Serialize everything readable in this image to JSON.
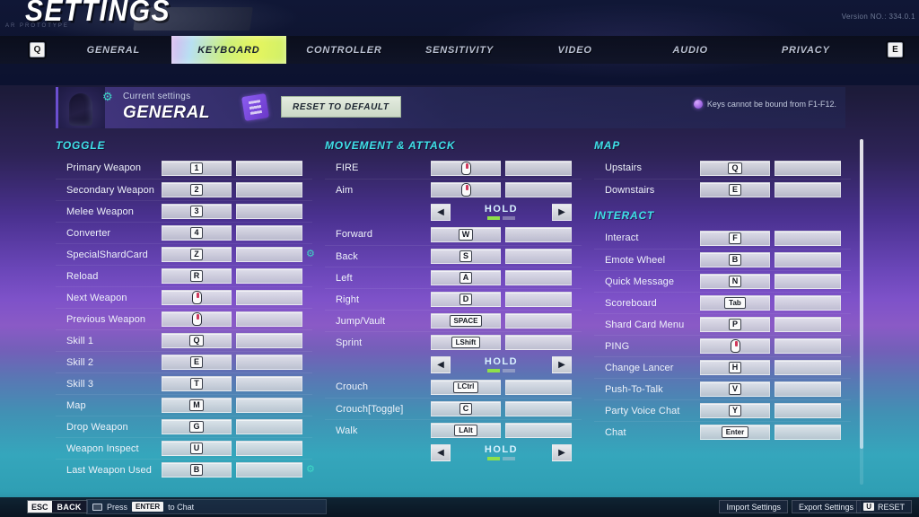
{
  "header": {
    "title": "SETTINGS",
    "subtitle": "AR  PROTOTYPE",
    "version": "Version NO.: 334.0.1"
  },
  "tabbar": {
    "left_key": "Q",
    "right_key": "E",
    "tabs": [
      {
        "label": "GENERAL",
        "active": false
      },
      {
        "label": "KEYBOARD",
        "active": true
      },
      {
        "label": "CONTROLLER",
        "active": false
      },
      {
        "label": "SENSITIVITY",
        "active": false
      },
      {
        "label": "VIDEO",
        "active": false
      },
      {
        "label": "AUDIO",
        "active": false
      },
      {
        "label": "PRIVACY",
        "active": false
      }
    ]
  },
  "current_settings": {
    "label": "Current settings",
    "value": "GENERAL",
    "reset_to_default": "RESET TO DEFAULT",
    "warning": "Keys cannot be bound from F1-F12."
  },
  "columns": {
    "left": {
      "section": "TOGGLE",
      "rows": [
        {
          "label": "Primary Weapon",
          "key": "1",
          "type": "key",
          "secondary": ""
        },
        {
          "label": "Secondary Weapon",
          "key": "2",
          "type": "key",
          "secondary": ""
        },
        {
          "label": "Melee Weapon",
          "key": "3",
          "type": "key",
          "secondary": ""
        },
        {
          "label": "Converter",
          "key": "4",
          "type": "key",
          "secondary": ""
        },
        {
          "label": "SpecialShardCard",
          "key": "Z",
          "type": "key",
          "secondary": "",
          "gear": true
        },
        {
          "label": "Reload",
          "key": "R",
          "type": "key",
          "secondary": ""
        },
        {
          "label": "Next Weapon",
          "key": "",
          "type": "mouse",
          "secondary": ""
        },
        {
          "label": "Previous Weapon",
          "key": "",
          "type": "mouse",
          "secondary": ""
        },
        {
          "label": "Skill 1",
          "key": "Q",
          "type": "key",
          "secondary": ""
        },
        {
          "label": "Skill 2",
          "key": "E",
          "type": "key",
          "secondary": ""
        },
        {
          "label": "Skill 3",
          "key": "T",
          "type": "key",
          "secondary": ""
        },
        {
          "label": "Map",
          "key": "M",
          "type": "key",
          "secondary": ""
        },
        {
          "label": "Drop Weapon",
          "key": "G",
          "type": "key",
          "secondary": ""
        },
        {
          "label": "Weapon Inspect",
          "key": "U",
          "type": "key",
          "secondary": ""
        },
        {
          "label": "Last Weapon Used",
          "key": "B",
          "type": "key",
          "secondary": "",
          "gear": true
        }
      ]
    },
    "mid": {
      "section": "MOVEMENT & ATTACK",
      "rows": [
        {
          "label": "FIRE",
          "key": "",
          "type": "mouse",
          "secondary": ""
        },
        {
          "label": "Aim",
          "key": "",
          "type": "mouse",
          "secondary": ""
        },
        {
          "label": "",
          "type": "hold",
          "hold_text": "HOLD",
          "segments": 2,
          "active_segment": 1
        },
        {
          "label": "Forward",
          "key": "W",
          "type": "key",
          "secondary": ""
        },
        {
          "label": "Back",
          "key": "S",
          "type": "key",
          "secondary": ""
        },
        {
          "label": "Left",
          "key": "A",
          "type": "key",
          "secondary": ""
        },
        {
          "label": "Right",
          "key": "D",
          "type": "key",
          "secondary": ""
        },
        {
          "label": "Jump/Vault",
          "key": "SPACE",
          "type": "key",
          "secondary": "",
          "wide": true
        },
        {
          "label": "Sprint",
          "key": "LShift",
          "type": "key",
          "secondary": "",
          "wide": true
        },
        {
          "label": "",
          "type": "hold",
          "hold_text": "HOLD",
          "segments": 2,
          "active_segment": 1
        },
        {
          "label": "Crouch",
          "key": "LCtrl",
          "type": "key",
          "secondary": "",
          "wide": true
        },
        {
          "label": "Crouch[Toggle]",
          "key": "C",
          "type": "key",
          "secondary": ""
        },
        {
          "label": "Walk",
          "key": "LAlt",
          "type": "key",
          "secondary": "",
          "wide": true
        },
        {
          "label": "",
          "type": "hold",
          "hold_text": "HOLD",
          "segments": 2,
          "active_segment": 1
        }
      ]
    },
    "right": {
      "section": "MAP",
      "rows": [
        {
          "label": "Upstairs",
          "key": "Q",
          "type": "key",
          "secondary": ""
        },
        {
          "label": "Downstairs",
          "key": "E",
          "type": "key",
          "secondary": ""
        }
      ],
      "section2": "INTERACT",
      "rows2": [
        {
          "label": "Interact",
          "key": "F",
          "type": "key",
          "secondary": ""
        },
        {
          "label": "Emote Wheel",
          "key": "B",
          "type": "key",
          "secondary": ""
        },
        {
          "label": "Quick Message",
          "key": "N",
          "type": "key",
          "secondary": ""
        },
        {
          "label": "Scoreboard",
          "key": "Tab",
          "type": "key",
          "secondary": "",
          "wide": true
        },
        {
          "label": "Shard Card Menu",
          "key": "P",
          "type": "key",
          "secondary": ""
        },
        {
          "label": "PING",
          "key": "",
          "type": "mouse",
          "secondary": ""
        },
        {
          "label": "Change Lancer",
          "key": "H",
          "type": "key",
          "secondary": ""
        },
        {
          "label": "Push-To-Talk",
          "key": "V",
          "type": "key",
          "secondary": ""
        },
        {
          "label": "Party Voice Chat",
          "key": "Y",
          "type": "key",
          "secondary": ""
        },
        {
          "label": "Chat",
          "key": "Enter",
          "type": "key",
          "secondary": "",
          "wide": true
        }
      ]
    }
  },
  "bottombar": {
    "esc_key": "ESC",
    "esc_label": "BACK",
    "chat_prefix": "Press",
    "chat_key": "ENTER",
    "chat_suffix": "to Chat",
    "import_settings": "Import Settings",
    "export_settings": "Export Settings",
    "reset_key": "U",
    "reset_label": "RESET"
  },
  "colors": {
    "accent_cyan": "#3fe0e8",
    "active_tab": "#e6f55e",
    "hold_active": "#8ee04a",
    "panel_purple": "#6b4fd0"
  }
}
